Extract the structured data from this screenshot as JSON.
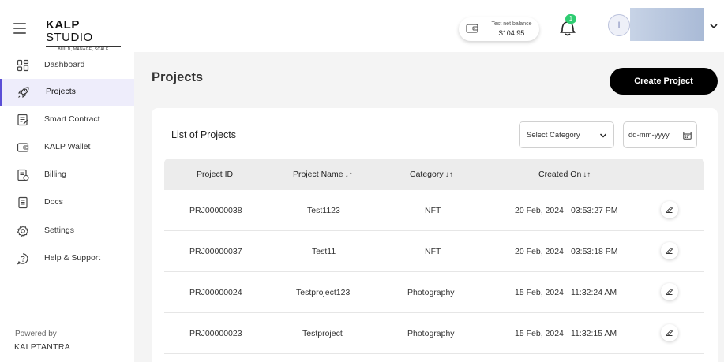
{
  "header": {
    "logo_bold": "KALP",
    "logo_thin": "STUDIO",
    "logo_tagline": "BUILD, MANAGE, SCALE",
    "balance_label": "Test net balance",
    "balance_value": "$104.95",
    "notification_count": "1",
    "avatar_initial": "I"
  },
  "sidebar": {
    "items": [
      {
        "label": "Dashboard",
        "icon": "dashboard-icon"
      },
      {
        "label": "Projects",
        "icon": "rocket-icon",
        "active": true
      },
      {
        "label": "Smart Contract",
        "icon": "contract-icon"
      },
      {
        "label": "KALP Wallet",
        "icon": "wallet-icon"
      },
      {
        "label": "Billing",
        "icon": "billing-icon"
      },
      {
        "label": "Docs",
        "icon": "docs-icon"
      },
      {
        "label": "Settings",
        "icon": "gear-icon"
      },
      {
        "label": "Help & Support",
        "icon": "help-icon"
      }
    ],
    "powered_by": "Powered by",
    "company": "KALPTANTRA"
  },
  "main": {
    "page_title": "Projects",
    "create_button": "Create Project",
    "list_title": "List of Projects",
    "category_select": "Select Category",
    "date_placeholder": "dd-mm-yyyy",
    "columns": [
      "Project ID",
      "Project Name",
      "Category",
      "Created On"
    ],
    "rows": [
      {
        "id": "PRJ00000038",
        "name": "Test1123",
        "category": "NFT",
        "date": "20 Feb, 2024",
        "time": "03:53:27 PM"
      },
      {
        "id": "PRJ00000037",
        "name": "Test11",
        "category": "NFT",
        "date": "20 Feb, 2024",
        "time": "03:53:18 PM"
      },
      {
        "id": "PRJ00000024",
        "name": "Testproject123",
        "category": "Photography",
        "date": "15 Feb, 2024",
        "time": "11:32:24 AM"
      },
      {
        "id": "PRJ00000023",
        "name": "Testproject",
        "category": "Photography",
        "date": "15 Feb, 2024",
        "time": "11:32:15 AM"
      }
    ]
  },
  "colors": {
    "accent": "#5b4fd6",
    "active_bg": "#eeedfb",
    "badge": "#2ecc71",
    "primary_button": "#000000"
  }
}
